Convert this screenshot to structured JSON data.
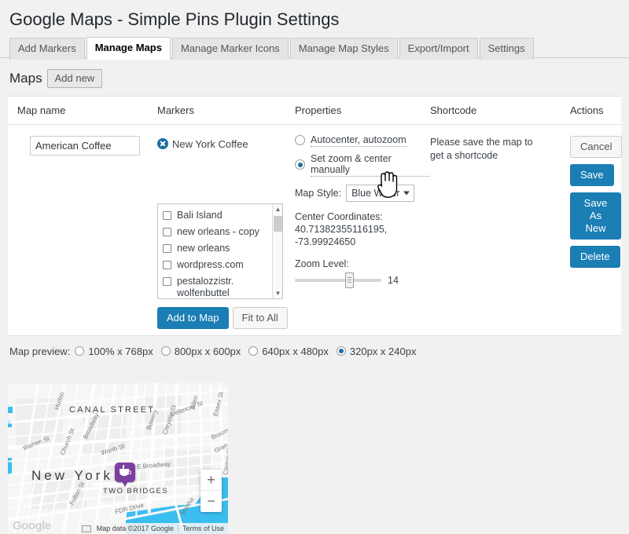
{
  "page": {
    "title": "Google Maps - Simple Pins Plugin Settings"
  },
  "tabs": [
    {
      "label": "Add Markers",
      "active": false
    },
    {
      "label": "Manage Maps",
      "active": true
    },
    {
      "label": "Manage Marker Icons",
      "active": false
    },
    {
      "label": "Manage Map Styles",
      "active": false
    },
    {
      "label": "Export/Import",
      "active": false
    },
    {
      "label": "Settings",
      "active": false
    }
  ],
  "maps_section": {
    "heading": "Maps",
    "add_new_label": "Add new"
  },
  "table": {
    "headers": [
      "Map name",
      "Markers",
      "Properties",
      "Shortcode",
      "Actions"
    ]
  },
  "row": {
    "map_name_value": "American Coffee",
    "map_name_placeholder": "Map name",
    "markers": [
      {
        "label": "New York Coffee"
      }
    ],
    "marker_list": [
      {
        "label": "Bali Island",
        "checked": false
      },
      {
        "label": "new orleans - copy",
        "checked": false
      },
      {
        "label": "new orleans",
        "checked": false
      },
      {
        "label": "wordpress.com",
        "checked": false
      },
      {
        "label": "pestalozzistr. wolfenbuttel",
        "checked": false
      }
    ],
    "list_buttons": {
      "add_to_map": "Add to Map",
      "fit_to_all": "Fit to All"
    },
    "properties": {
      "autocenter_label": "Autocenter, autozoom",
      "manual_label": "Set zoom & center manually",
      "selected_mode": "manual",
      "map_style_label": "Map Style:",
      "map_style_value": "Blue Water",
      "center_coordinates_label": "Center Coordinates:",
      "center_coordinates_value": "40.71382355116195, -73.99924650",
      "zoom_level_label": "Zoom Level:",
      "zoom_level_value": "14"
    },
    "shortcode_text": "Please save the map to get a shortcode",
    "actions": [
      {
        "label": "Cancel",
        "style": "secondary"
      },
      {
        "label": "Save",
        "style": "primary"
      },
      {
        "label": "Save As New",
        "style": "primary"
      },
      {
        "label": "Delete",
        "style": "primary"
      }
    ]
  },
  "preview": {
    "label": "Map preview:",
    "options": [
      {
        "label": "100% x 768px",
        "selected": false
      },
      {
        "label": "800px x 600px",
        "selected": false
      },
      {
        "label": "640px x 480px",
        "selected": false
      },
      {
        "label": "320px x 240px",
        "selected": true
      }
    ]
  },
  "map": {
    "labels": {
      "canal_street": "CANAL STREET",
      "new_york": "New York",
      "two_bridges": "TWO BRIDGES"
    },
    "street_labels": [
      "Hudso",
      "Broadway",
      "Warren St",
      "Church St",
      "Worth St",
      "Bowery",
      "Chrystie St",
      "Delancey St",
      "Allen",
      "Essex St",
      "Broom",
      "Gran",
      "Clinton St",
      "E Broadway",
      "Fulton St",
      "FDR Drive",
      "Manha",
      "Two Bridges"
    ],
    "google_logo": "Google",
    "attribution": "Map data ©2017 Google",
    "terms": "Terms of Use",
    "zoom_in": "+",
    "zoom_out": "−",
    "marker_icon": "coffee-cup-pin"
  },
  "colors": {
    "accent_blue": "#1b7eb4",
    "water": "#3bbdf0",
    "pin_purple": "#7b3fa0",
    "page_bg": "#f1f1f1"
  }
}
